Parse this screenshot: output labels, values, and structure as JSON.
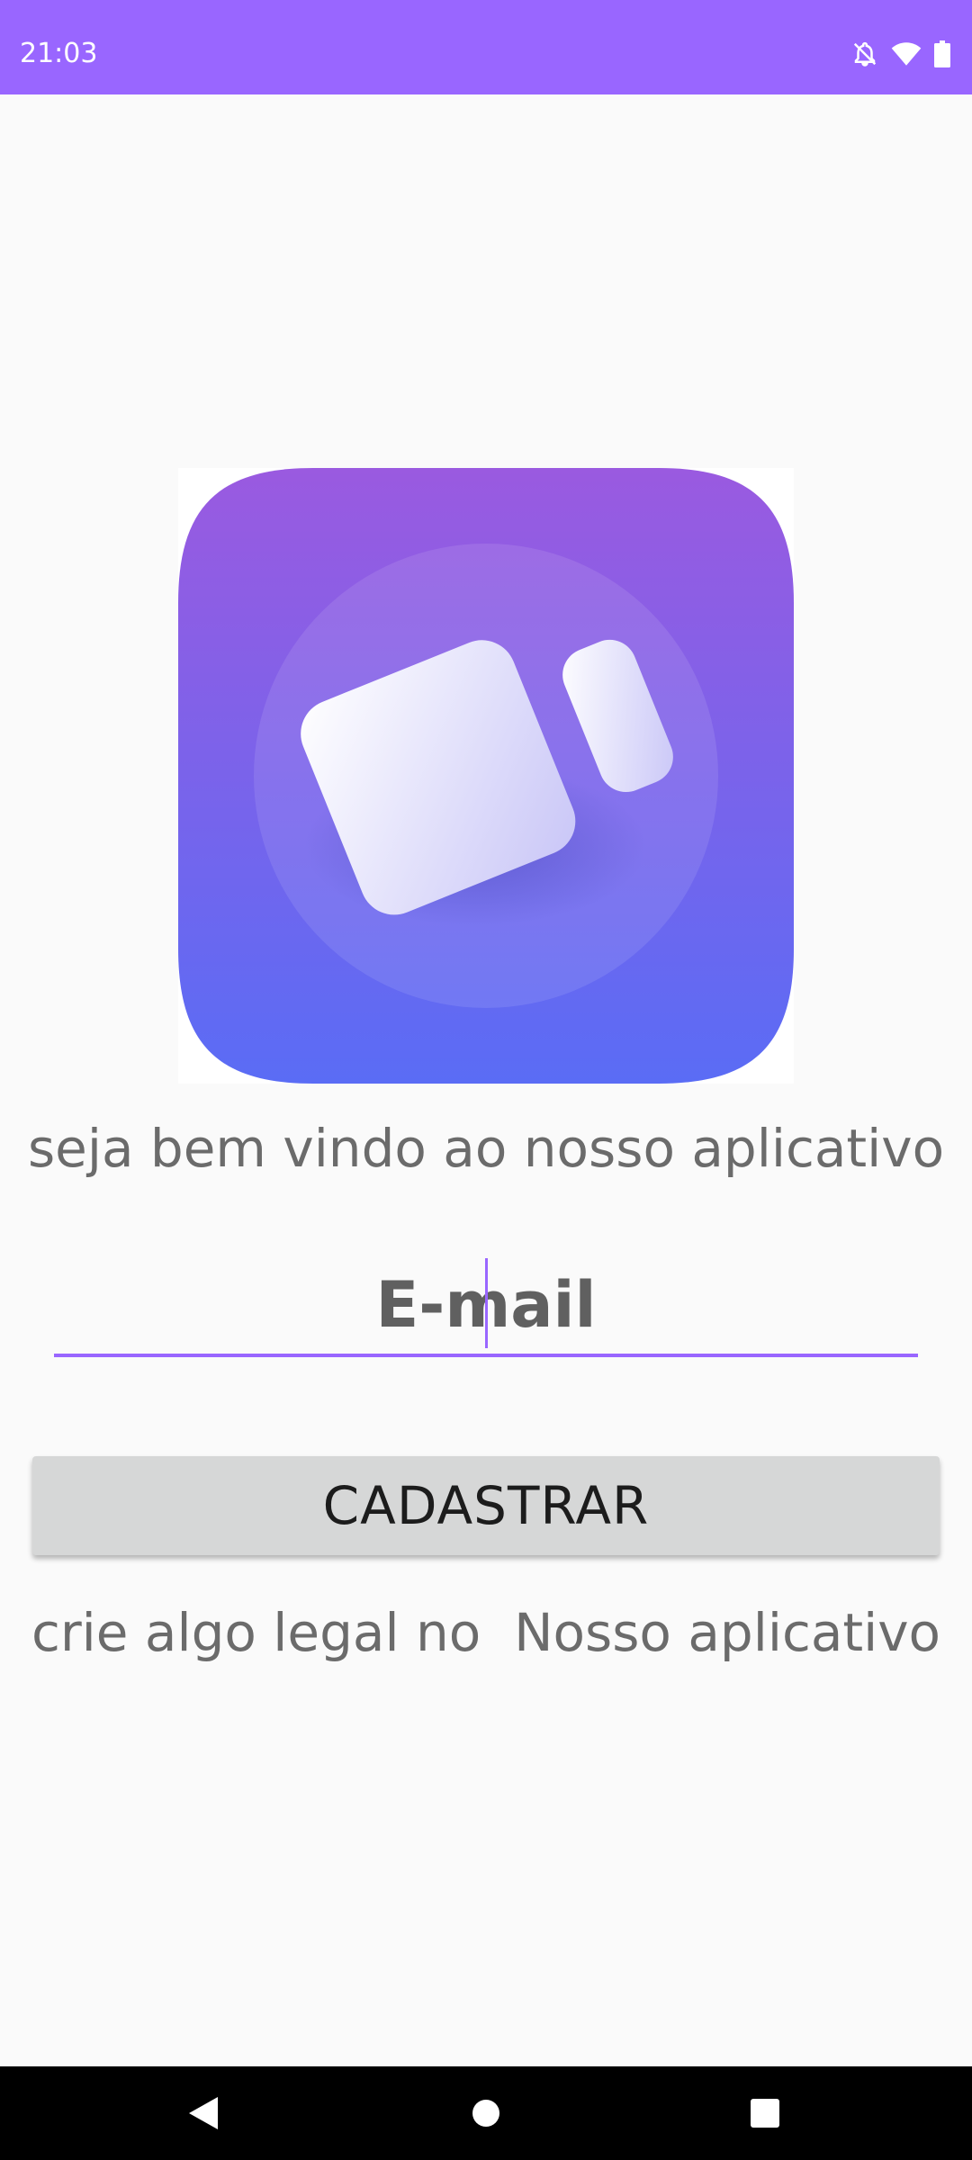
{
  "status_bar": {
    "time": "21:03",
    "icons": [
      "bell-off-icon",
      "wifi-icon",
      "battery-icon"
    ],
    "background": "#9966ff"
  },
  "main": {
    "logo_icon": "video-camera-app-icon",
    "welcome_text": "seja bem vindo ao nosso aplicativo",
    "email_placeholder": "E-mail",
    "register_button": "CADASTRAR",
    "tagline_text": "crie algo legal no  Nosso aplicativo"
  },
  "colors": {
    "accent": "#9966ff",
    "button_bg": "#d6d7d7",
    "text": "#6b6b6b"
  },
  "nav_bar": {
    "buttons": [
      "back-icon",
      "home-icon",
      "recents-icon"
    ]
  }
}
